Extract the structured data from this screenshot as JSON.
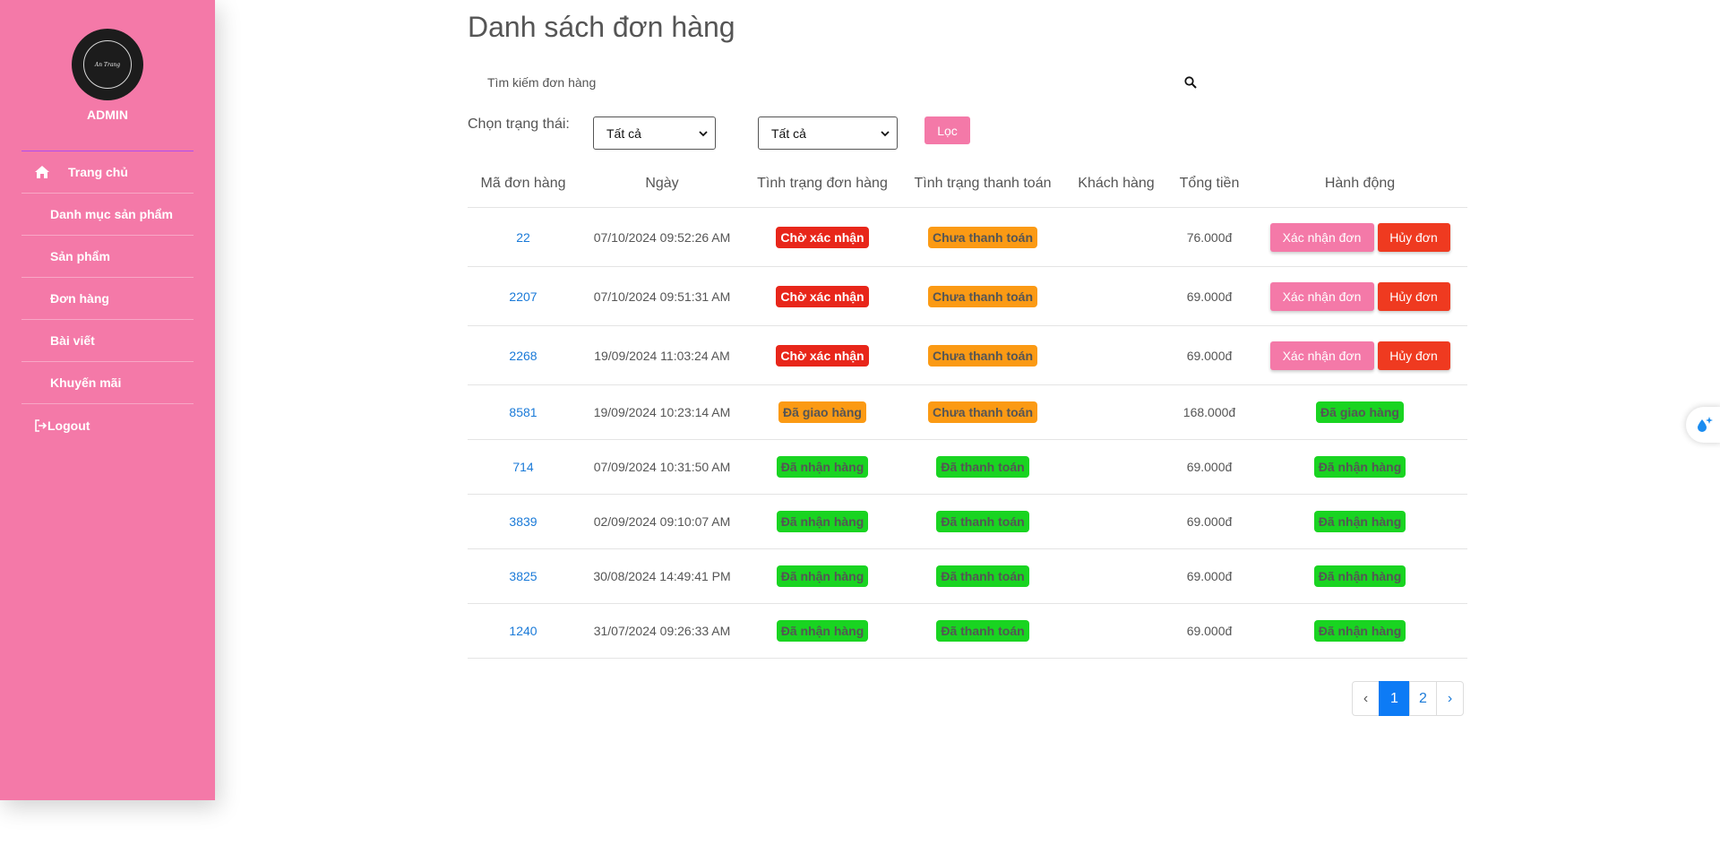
{
  "sidebar": {
    "logo_text": "An Trang",
    "role": "ADMIN",
    "items": [
      {
        "label": "Trang chủ",
        "icon": "home-icon"
      },
      {
        "label": "Danh mục sản phẩm"
      },
      {
        "label": "Sản phẩm"
      },
      {
        "label": "Đơn hàng"
      },
      {
        "label": "Bài viết"
      },
      {
        "label": "Khuyến mãi"
      }
    ],
    "logout": {
      "label": "Logout",
      "icon": "logout-icon"
    },
    "bg_color": "#f479a8"
  },
  "header": {
    "title": "Danh sách đơn hàng"
  },
  "search": {
    "placeholder": "Tìm kiếm đơn hàng",
    "value": "",
    "icon": "search-icon"
  },
  "filter": {
    "label": "Chọn trạng thái:",
    "select_1_value": "Tất cả",
    "select_2_value": "Tất cả",
    "button_label": "Lọc"
  },
  "table": {
    "columns": [
      "Mã đơn hàng",
      "Ngày",
      "Tình trạng đơn hàng",
      "Tình trạng thanh toán",
      "Khách hàng",
      "Tổng tiền",
      "Hành động"
    ],
    "rows": [
      {
        "id": "22",
        "date": "07/10/2024 09:52:26 AM",
        "order_status": "Chờ xác nhận",
        "order_status_color": "red",
        "payment_status": "Chưa thanh toán",
        "payment_color": "orange",
        "customer": "",
        "total": "76.000đ",
        "action_type": "buttons",
        "confirm_label": "Xác nhận đơn",
        "cancel_label": "Hủy đơn"
      },
      {
        "id": "2207",
        "date": "07/10/2024 09:51:31 AM",
        "order_status": "Chờ xác nhận",
        "order_status_color": "red",
        "payment_status": "Chưa thanh toán",
        "payment_color": "orange",
        "customer": "",
        "total": "69.000đ",
        "action_type": "buttons",
        "confirm_label": "Xác nhận đơn",
        "cancel_label": "Hủy đơn"
      },
      {
        "id": "2268",
        "date": "19/09/2024 11:03:24 AM",
        "order_status": "Chờ xác nhận",
        "order_status_color": "red",
        "payment_status": "Chưa thanh toán",
        "payment_color": "orange",
        "customer": "",
        "total": "69.000đ",
        "action_type": "buttons",
        "confirm_label": "Xác nhận đơn",
        "cancel_label": "Hủy đơn"
      },
      {
        "id": "8581",
        "date": "19/09/2024 10:23:14 AM",
        "order_status": "Đã giao hàng",
        "order_status_color": "orange",
        "payment_status": "Chưa thanh toán",
        "payment_color": "orange",
        "customer": "",
        "total": "168.000đ",
        "action_type": "badge",
        "action_badge": "Đã giao hàng"
      },
      {
        "id": "714",
        "date": "07/09/2024 10:31:50 AM",
        "order_status": "Đã nhận hàng",
        "order_status_color": "green",
        "payment_status": "Đã thanh toán",
        "payment_color": "green",
        "customer": "",
        "total": "69.000đ",
        "action_type": "badge",
        "action_badge": "Đã nhận hàng"
      },
      {
        "id": "3839",
        "date": "02/09/2024 09:10:07 AM",
        "order_status": "Đã nhận hàng",
        "order_status_color": "green",
        "payment_status": "Đã thanh toán",
        "payment_color": "green",
        "customer": "",
        "total": "69.000đ",
        "action_type": "badge",
        "action_badge": "Đã nhận hàng"
      },
      {
        "id": "3825",
        "date": "30/08/2024 14:49:41 PM",
        "order_status": "Đã nhận hàng",
        "order_status_color": "green",
        "payment_status": "Đã thanh toán",
        "payment_color": "green",
        "customer": "",
        "total": "69.000đ",
        "action_type": "badge",
        "action_badge": "Đã nhận hàng"
      },
      {
        "id": "1240",
        "date": "31/07/2024 09:26:33 AM",
        "order_status": "Đã nhận hàng",
        "order_status_color": "green",
        "payment_status": "Đã thanh toán",
        "payment_color": "green",
        "customer": "",
        "total": "69.000đ",
        "action_type": "badge",
        "action_badge": "Đã nhận hàng"
      }
    ]
  },
  "pagination": {
    "prev": "‹",
    "pages": [
      "1",
      "2"
    ],
    "current": "1",
    "next": "›"
  },
  "colors": {
    "accent": "#f479a8",
    "red": "#e8261a",
    "orange": "#fb9a14",
    "green": "#19d421",
    "link": "#1a7ad8",
    "page_active": "#0d7bf5"
  }
}
